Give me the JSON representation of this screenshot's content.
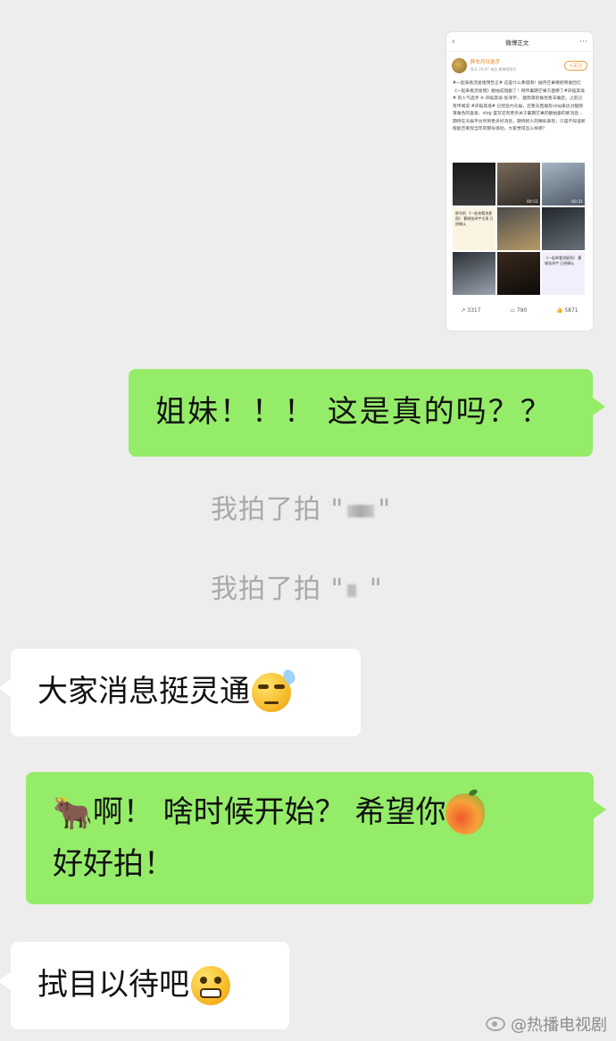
{
  "shared_image": {
    "header_title": "微博正文",
    "author_name": "胖车月日选手",
    "author_meta": "昨天 20:07 来自 微博视频号",
    "follow_label": "+关注",
    "post_text": "#一起来看流星雨预告正# 这是什么弗塔啊！据传芒果要把青春回忆《一起来看流星雨》翻拍成短剧了！网传暑期芒果方面要了#声临其境# 的人气选手 ※ 声临其境-张泽宇， 楚雨荨的角色暂未确定。之前已有传闻说 #声临其境# 已经签约天娱，还要去直播及vlog表达对楚雨荨角色的喜爱。vlog 里写还有更多关于暑期芒果的翻拍剧的新消息... 期待在天娱平台听到更多好消息，期待新人的精彩表现，只是不知道新版能否重现当年的那份感动。大家觉得怎么样呢？",
    "grid_durations": [
      "",
      "00:51",
      "00:31",
      "",
      "",
      "",
      "",
      "",
      ""
    ],
    "grid_captions": [
      "",
      "",
      "",
      "胖车拍\n《一起来看流星雨》\n暮城张泽宇主演\n已经确认",
      "",
      "",
      "",
      "",
      "《一起来看流星雨》\n暮城张泽宇\n已经确认"
    ],
    "repost_count": "3317",
    "comment_count": "790",
    "like_count": "5871"
  },
  "messages": [
    {
      "side": "out",
      "text": "姐妹！！！ 这是真的吗？？"
    },
    {
      "side": "system",
      "text": "我拍了拍 \""
    },
    {
      "side": "system",
      "text": "我拍了拍 \""
    },
    {
      "side": "in",
      "text": "大家消息挺灵通",
      "emoji": "sweat-smile-icon"
    },
    {
      "side": "out",
      "text_a": "啊！ 啥时候开始？ 希望你",
      "text_b": "好好拍！",
      "emoji_a": "cow-icon",
      "emoji_b": "mango-icon"
    },
    {
      "side": "in",
      "text": "拭目以待吧",
      "emoji": "grin-icon"
    }
  ],
  "pat_close_quote": "\"",
  "watermark": "@热播电视剧"
}
